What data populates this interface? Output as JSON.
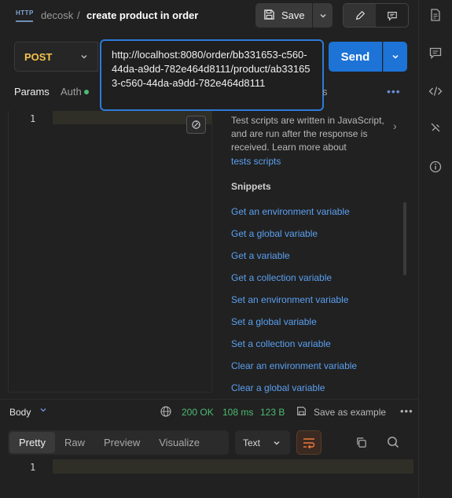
{
  "header": {
    "request_type_icon": "http-icon",
    "request_type_text": "HTTP",
    "breadcrumb_parent": "decosk",
    "breadcrumb_separator": "/",
    "title": "create product in order",
    "save_label": "Save"
  },
  "request": {
    "method": "POST",
    "url": "http://localhost:8080/order/bb331653-c560-44da-a9dd-782e464d8111/product/ab331653-c560-44da-a9dd-782e464d8111",
    "send_label": "Send"
  },
  "tabs": {
    "params": "Params",
    "auth": "Auth",
    "partial": "s",
    "more": "•••"
  },
  "editor": {
    "line_number": "1"
  },
  "scripts_panel": {
    "info_text": "Test scripts are written in JavaScript, and are run after the response is received. Learn more about",
    "info_link": "tests scripts",
    "snippets_heading": "Snippets",
    "snippets": [
      "Get an environment variable",
      "Get a global variable",
      "Get a variable",
      "Get a collection variable",
      "Set an environment variable",
      "Set a global variable",
      "Set a collection variable",
      "Clear an environment variable",
      "Clear a global variable"
    ]
  },
  "response": {
    "body_label": "Body",
    "status": "200 OK",
    "time": "108 ms",
    "size": "123 B",
    "save_example": "Save as example",
    "more": "•••",
    "tabs": [
      "Pretty",
      "Raw",
      "Preview",
      "Visualize"
    ],
    "format": "Text",
    "line_number": "1"
  },
  "colors": {
    "accent": "#1d73d6",
    "method": "#f5c34b",
    "success": "#4cbb72",
    "link": "#5aa0f0"
  }
}
